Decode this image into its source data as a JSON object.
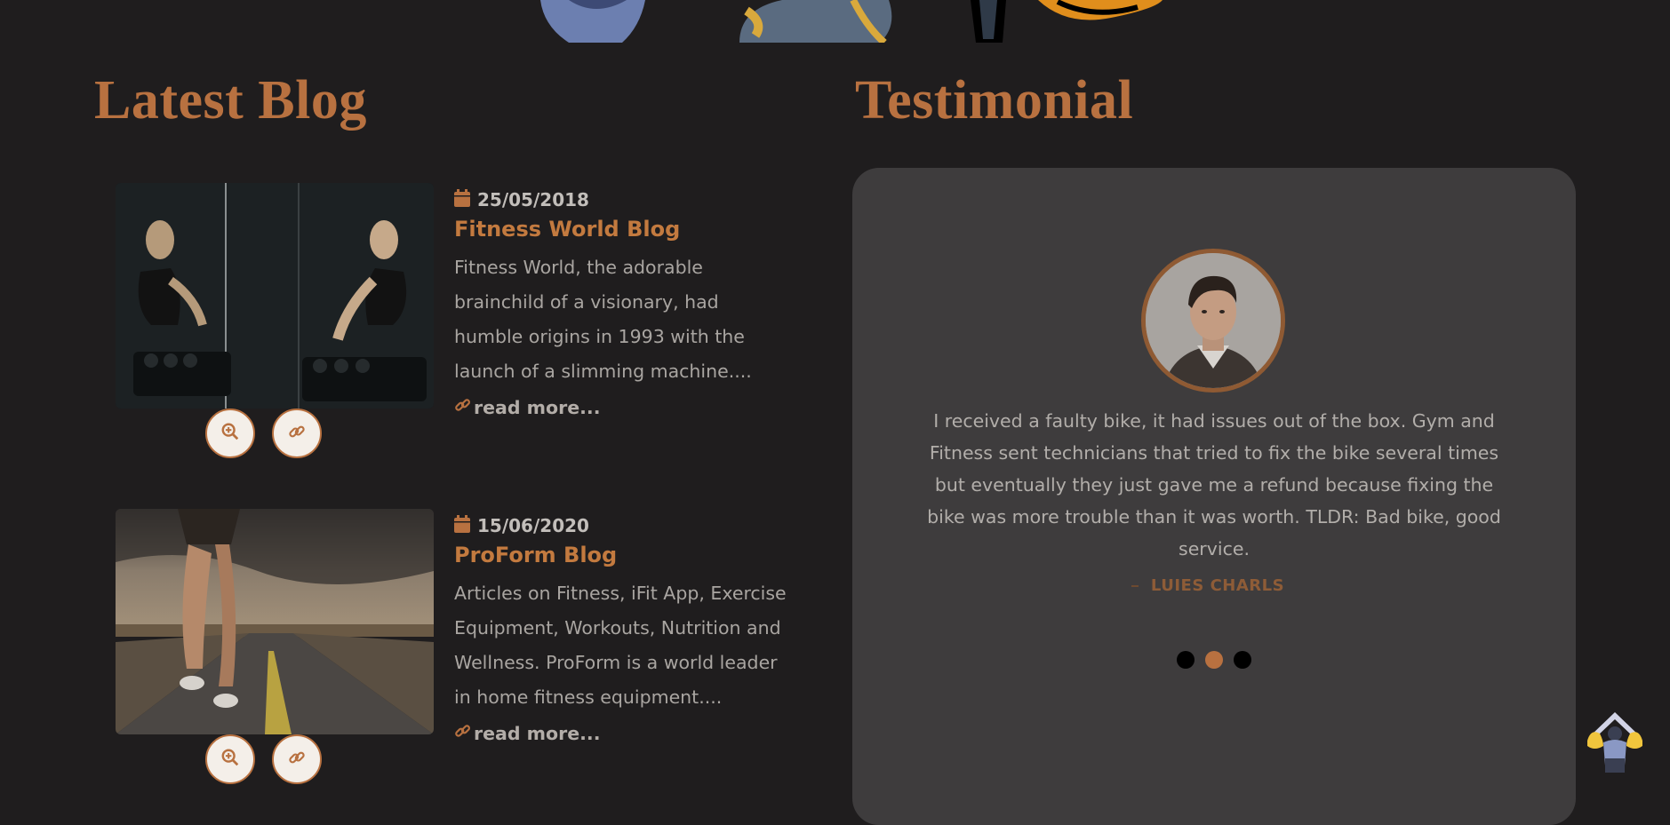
{
  "blog": {
    "title": "Latest Blog",
    "posts": [
      {
        "image": "woman-dumbbell-mirror-photo",
        "date": "25/05/2018",
        "title": "Fitness World Blog",
        "excerpt": "Fitness World, the adorable brainchild of a visionary, had humble origins in 1993 with the launch of a slimming machine....",
        "read_more": "read more..."
      },
      {
        "image": "runner-on-road-photo",
        "date": "15/06/2020",
        "title": "ProForm Blog",
        "excerpt": "Articles on Fitness, iFit App, Exercise Equipment, Workouts, Nutrition and Wellness. ProForm is a world leader in home fitness equipment....",
        "read_more": "read more..."
      }
    ],
    "icons": {
      "date": "calendar-icon",
      "zoom": "zoom-in-icon",
      "link": "link-icon"
    }
  },
  "testimonial": {
    "title": "Testimonial",
    "avatar": "man-portrait-photo",
    "quote": "I received a faulty bike, it had issues out of the box. Gym and Fitness sent technicians that tried to fix the bike several times but eventually they just gave me a refund because fixing the bike was more trouble than it was worth. TLDR: Bad bike, good service.",
    "author": "LUIES CHARLS",
    "slides": 3,
    "active_slide": 2
  },
  "scroll_top_icon": "flexing-strongman-icon",
  "colors": {
    "background": "#1f1d1e",
    "accent": "#b87140",
    "card": "#3e3c3d",
    "text": "#a9a5a1"
  }
}
